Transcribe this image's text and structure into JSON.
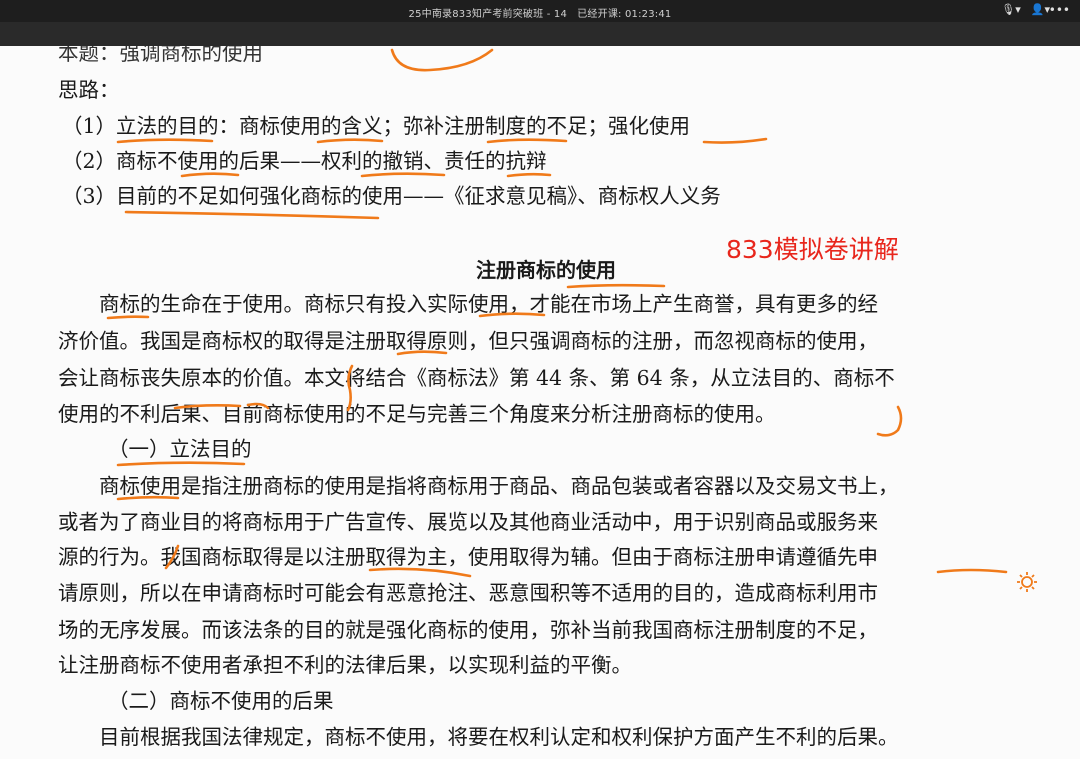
{
  "window": {
    "title": "25中南录833知产考前突破班 - 14　已经开课: 01:23:41",
    "controls": {
      "mic": "🎙▾",
      "user": "👤▾",
      "more": "•••"
    }
  },
  "doc": {
    "topic": "本题：强调商标的使用",
    "idea_label": "思路：",
    "points": [
      "（1）立法的目的：商标使用的含义；弥补注册制度的不足；强化使用",
      "（2）商标不使用的后果——权利的撤销、责任的抗辩",
      "（3）目前的不足如何强化商标的使用——《征求意见稿》、商标权人义务"
    ],
    "heading": "注册商标的使用",
    "overlay_note": "833模拟卷讲解",
    "para1": [
      "　　商标的生命在于使用。商标只有投入实际使用，才能在市场上产生商誉，具有更多的经",
      "济价值。我国是商标权的取得是注册取得原则，但只强调商标的注册，而忽视商标的使用，",
      "会让商标丧失原本的价值。本文将结合《商标法》第 44 条、第 64 条，从立法目的、商标不",
      "使用的不利后果、目前商标使用的不足与完善三个角度来分析注册商标的使用。"
    ],
    "section1": "（一）立法目的",
    "para2": [
      "　　商标使用是指注册商标的使用是指将商标用于商品、商品包装或者容器以及交易文书上，",
      "或者为了商业目的将商标用于广告宣传、展览以及其他商业活动中，用于识别商品或服务来",
      "源的行为。我国商标取得是以注册取得为主，使用取得为辅。但由于商标注册申请遵循先申",
      "请原则，所以在申请商标时可能会有恶意抢注、恶意囤积等不适用的目的，造成商标利用市",
      "场的无序发展。而该法条的目的就是强化商标的使用，弥补当前我国商标注册制度的不足，",
      "让注册商标不使用者承担不利的法律后果，以实现利益的平衡。"
    ],
    "section2": "（二）商标不使用的后果",
    "para3": [
      "　　目前根据我国法律规定，商标不使用，将要在权利认定和权利保护方面产生不利的后果。"
    ]
  },
  "colors": {
    "ink": "#f07a1a",
    "note": "#e8261c",
    "page": "#fbfbfb",
    "chrome": "#1e1e1e"
  }
}
